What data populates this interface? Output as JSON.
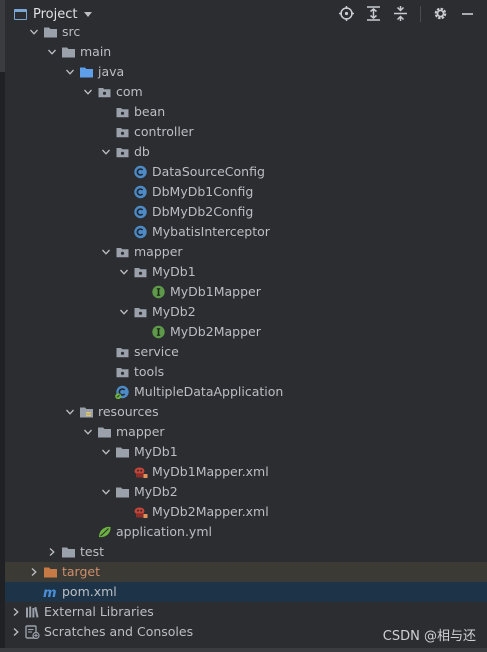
{
  "header": {
    "title": "Project"
  },
  "tree": [
    {
      "label": "src",
      "depth": 1,
      "arrow": "down",
      "icon": "folder-plain"
    },
    {
      "label": "main",
      "depth": 2,
      "arrow": "down",
      "icon": "folder-plain"
    },
    {
      "label": "java",
      "depth": 3,
      "arrow": "down",
      "icon": "folder-blue"
    },
    {
      "label": "com",
      "depth": 4,
      "arrow": "down",
      "icon": "package"
    },
    {
      "label": "bean",
      "depth": 5,
      "arrow": "none",
      "icon": "package"
    },
    {
      "label": "controller",
      "depth": 5,
      "arrow": "none",
      "icon": "package"
    },
    {
      "label": "db",
      "depth": 5,
      "arrow": "down",
      "icon": "package"
    },
    {
      "label": "DataSourceConfig",
      "depth": 6,
      "arrow": "none",
      "icon": "class"
    },
    {
      "label": "DbMyDb1Config",
      "depth": 6,
      "arrow": "none",
      "icon": "class"
    },
    {
      "label": "DbMyDb2Config",
      "depth": 6,
      "arrow": "none",
      "icon": "class"
    },
    {
      "label": "MybatisInterceptor",
      "depth": 6,
      "arrow": "none",
      "icon": "class"
    },
    {
      "label": "mapper",
      "depth": 5,
      "arrow": "down",
      "icon": "package"
    },
    {
      "label": "MyDb1",
      "depth": 6,
      "arrow": "down",
      "icon": "package"
    },
    {
      "label": "MyDb1Mapper",
      "depth": 7,
      "arrow": "none",
      "icon": "interface"
    },
    {
      "label": "MyDb2",
      "depth": 6,
      "arrow": "down",
      "icon": "package"
    },
    {
      "label": "MyDb2Mapper",
      "depth": 7,
      "arrow": "none",
      "icon": "interface"
    },
    {
      "label": "service",
      "depth": 5,
      "arrow": "none",
      "icon": "package"
    },
    {
      "label": "tools",
      "depth": 5,
      "arrow": "none",
      "icon": "package"
    },
    {
      "label": "MultipleDataApplication",
      "depth": 5,
      "arrow": "none",
      "icon": "spring-class"
    },
    {
      "label": "resources",
      "depth": 3,
      "arrow": "down",
      "icon": "folder-resources"
    },
    {
      "label": "mapper",
      "depth": 4,
      "arrow": "down",
      "icon": "folder-plain"
    },
    {
      "label": "MyDb1",
      "depth": 5,
      "arrow": "down",
      "icon": "folder-plain"
    },
    {
      "label": "MyDb1Mapper.xml",
      "depth": 6,
      "arrow": "none",
      "icon": "mybatis-xml"
    },
    {
      "label": "MyDb2",
      "depth": 5,
      "arrow": "down",
      "icon": "folder-plain"
    },
    {
      "label": "MyDb2Mapper.xml",
      "depth": 6,
      "arrow": "none",
      "icon": "mybatis-xml"
    },
    {
      "label": "application.yml",
      "depth": 4,
      "arrow": "none",
      "icon": "spring-yml"
    },
    {
      "label": "test",
      "depth": 2,
      "arrow": "right",
      "icon": "folder-plain"
    },
    {
      "label": "target",
      "depth": 1,
      "arrow": "right",
      "icon": "folder-orange",
      "highlight": "target",
      "label_color": "orange"
    },
    {
      "label": "pom.xml",
      "depth": 1,
      "arrow": "none",
      "icon": "maven",
      "highlight": "pom"
    },
    {
      "label": "External Libraries",
      "depth": 0,
      "arrow": "right",
      "icon": "libraries"
    },
    {
      "label": "Scratches and Consoles",
      "depth": 0,
      "arrow": "right",
      "icon": "scratches"
    }
  ],
  "watermark": "CSDN @相与还",
  "colors": {
    "background": "#2b2d30",
    "text": "#bcbec4",
    "folder": "#9aa1ab",
    "folder_blue": "#5f9ee8",
    "class_badge": "#4e8bc6",
    "interface_badge": "#5f9a4a",
    "target_folder": "#c77a45",
    "maven": "#4a8fd6",
    "target_row_bg": "#3c3a34",
    "pom_row_bg": "#1d3347"
  },
  "toolbar_icons": [
    "target-locate-icon",
    "expand-all-icon",
    "collapse-all-icon",
    "gear-icon",
    "minimize-icon"
  ]
}
